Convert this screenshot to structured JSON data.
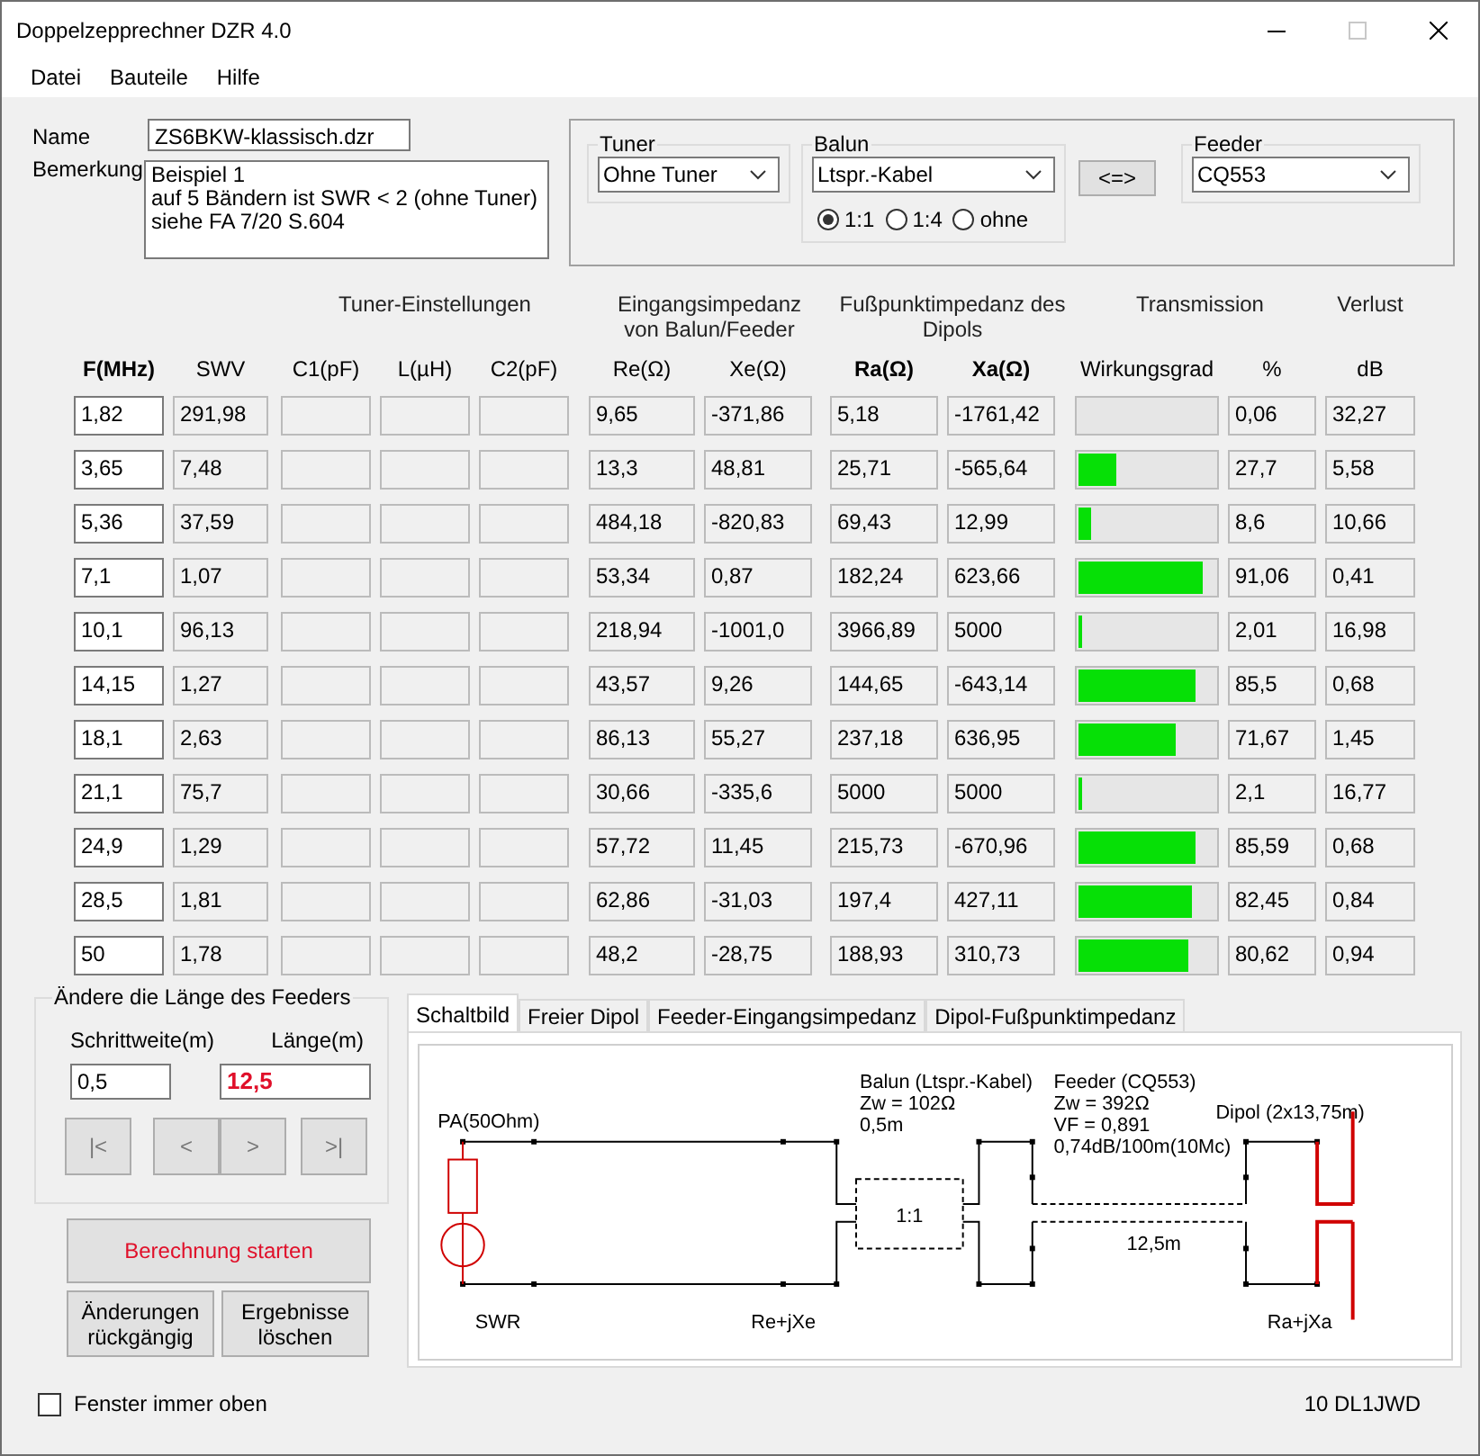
{
  "window": {
    "title": "Doppelzepprechner DZR 4.0"
  },
  "menu": [
    "Datei",
    "Bauteile",
    "Hilfe"
  ],
  "name": {
    "label": "Name",
    "value": "ZS6BKW-klassisch.dzr"
  },
  "remark": {
    "label": "Bemerkung",
    "lines": [
      "Beispiel 1",
      "auf 5 Bändern ist SWR < 2 (ohne Tuner)",
      "siehe FA 7/20 S.604"
    ]
  },
  "tuner": {
    "label": "Tuner",
    "value": "Ohne Tuner"
  },
  "balun": {
    "label": "Balun",
    "value": "Ltspr.-Kabel",
    "options": [
      {
        "label": "1:1",
        "selected": true
      },
      {
        "label": "1:4",
        "selected": false
      },
      {
        "label": "ohne",
        "selected": false
      }
    ]
  },
  "swap_button": "<=>",
  "feeder": {
    "label": "Feeder",
    "value": "CQ553"
  },
  "group_headers": [
    "Tuner-Einstellungen",
    "Eingangsimpedanz\nvon Balun/Feeder",
    "Fußpunktimpedanz des\nDipols",
    "Transmission",
    "Verlust"
  ],
  "columns": [
    {
      "label": "F(MHz)",
      "bold": true
    },
    {
      "label": "SWV",
      "bold": false
    },
    {
      "label": "C1(pF)",
      "bold": false
    },
    {
      "label": "L(µH)",
      "bold": false
    },
    {
      "label": "C2(pF)",
      "bold": false
    },
    {
      "label": "Re(Ω)",
      "bold": false
    },
    {
      "label": "Xe(Ω)",
      "bold": false
    },
    {
      "label": "Ra(Ω)",
      "bold": true
    },
    {
      "label": "Xa(Ω)",
      "bold": true
    },
    {
      "label": "Wirkungsgrad",
      "bold": false
    },
    {
      "label": "%",
      "bold": false
    },
    {
      "label": "dB",
      "bold": false
    }
  ],
  "rows": [
    {
      "f": "1,82",
      "swv": "291,98",
      "re": "9,65",
      "xe": "-371,86",
      "ra": "5,18",
      "xa": "-1761,42",
      "level": 0.0006,
      "pct": "0,06",
      "db": "32,27"
    },
    {
      "f": "3,65",
      "swv": "7,48",
      "re": "13,3",
      "xe": "48,81",
      "ra": "25,71",
      "xa": "-565,64",
      "level": 0.277,
      "pct": "27,7",
      "db": "5,58"
    },
    {
      "f": "5,36",
      "swv": "37,59",
      "re": "484,18",
      "xe": "-820,83",
      "ra": "69,43",
      "xa": "12,99",
      "level": 0.086,
      "pct": "8,6",
      "db": "10,66"
    },
    {
      "f": "7,1",
      "swv": "1,07",
      "re": "53,34",
      "xe": "0,87",
      "ra": "182,24",
      "xa": "623,66",
      "level": 0.9106,
      "pct": "91,06",
      "db": "0,41"
    },
    {
      "f": "10,1",
      "swv": "96,13",
      "re": "218,94",
      "xe": "-1001,0",
      "ra": "3966,89",
      "xa": "5000",
      "level": 0.0201,
      "pct": "2,01",
      "db": "16,98"
    },
    {
      "f": "14,15",
      "swv": "1,27",
      "re": "43,57",
      "xe": "9,26",
      "ra": "144,65",
      "xa": "-643,14",
      "level": 0.855,
      "pct": "85,5",
      "db": "0,68"
    },
    {
      "f": "18,1",
      "swv": "2,63",
      "re": "86,13",
      "xe": "55,27",
      "ra": "237,18",
      "xa": "636,95",
      "level": 0.7167,
      "pct": "71,67",
      "db": "1,45"
    },
    {
      "f": "21,1",
      "swv": "75,7",
      "re": "30,66",
      "xe": "-335,6",
      "ra": "5000",
      "xa": "5000",
      "level": 0.021,
      "pct": "2,1",
      "db": "16,77"
    },
    {
      "f": "24,9",
      "swv": "1,29",
      "re": "57,72",
      "xe": "11,45",
      "ra": "215,73",
      "xa": "-670,96",
      "level": 0.8559,
      "pct": "85,59",
      "db": "0,68"
    },
    {
      "f": "28,5",
      "swv": "1,81",
      "re": "62,86",
      "xe": "-31,03",
      "ra": "197,4",
      "xa": "427,11",
      "level": 0.8245,
      "pct": "82,45",
      "db": "0,84"
    },
    {
      "f": "50",
      "swv": "1,78",
      "re": "48,2",
      "xe": "-28,75",
      "ra": "188,93",
      "xa": "310,73",
      "level": 0.8062,
      "pct": "80,62",
      "db": "0,94"
    }
  ],
  "feeder_length": {
    "title": "Ändere die Länge des Feeders",
    "step_label": "Schrittweite(m)",
    "step": "0,5",
    "length_label": "Länge(m)",
    "length": "12,5",
    "nav": [
      {
        "label": "|<",
        "disabled": true
      },
      {
        "label": "<",
        "disabled": true
      },
      {
        "label": ">",
        "disabled": true
      },
      {
        "label": ">|",
        "disabled": true
      }
    ]
  },
  "start_button": "Berechnung starten",
  "undo_button": "Änderungen\nrückgängig",
  "clear_button": "Ergebnisse\nlöschen",
  "tabs": [
    {
      "label": "Schaltbild",
      "selected": true
    },
    {
      "label": "Freier Dipol",
      "selected": false
    },
    {
      "label": "Feeder-Eingangsimpedanz",
      "selected": false
    },
    {
      "label": "Dipol-Fußpunktimpedanz",
      "selected": false
    }
  ],
  "schematic": {
    "pa": "PA(50Ohm)",
    "balun": [
      "Balun (Ltspr.-Kabel)",
      "Zw = 102Ω",
      "0,5m"
    ],
    "ratio": "1:1",
    "feeder": [
      "Feeder (CQ553)",
      "Zw = 392Ω",
      "VF = 0,891",
      "0,74dB/100m(10Mc)"
    ],
    "dipol": "Dipol (2x13,75m)",
    "length": "12,5m",
    "swr": "SWR",
    "input": "Re+jXe",
    "output": "Ra+jXa"
  },
  "always_on_top": {
    "label": "Fenster immer oben",
    "checked": false
  },
  "status": "10 DL1JWD"
}
